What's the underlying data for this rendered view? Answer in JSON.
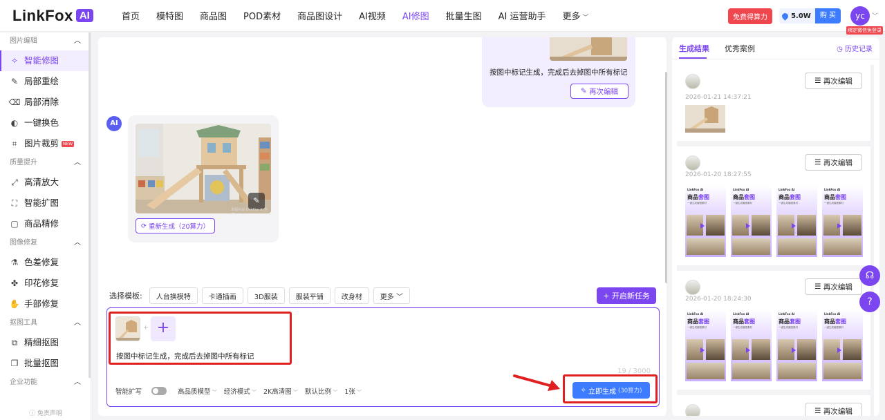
{
  "header": {
    "logo_text": "LinkFox",
    "logo_badge": "AI",
    "nav": [
      {
        "label": "首页"
      },
      {
        "label": "模特图"
      },
      {
        "label": "商品图"
      },
      {
        "label": "POD素材"
      },
      {
        "label": "商品图设计"
      },
      {
        "label": "AI视频"
      },
      {
        "label": "AI修图",
        "active": true
      },
      {
        "label": "批量生图"
      },
      {
        "label": "AI 运营助手"
      },
      {
        "label": "更多"
      }
    ],
    "free_power": "免费得算力",
    "power_value": "5.0W",
    "buy_label": "购 买",
    "avatar_initials": "yc",
    "bind_tag": "绑定微信免登录"
  },
  "sidebar": {
    "groups": [
      {
        "title": "图片编辑",
        "items": [
          {
            "label": "智能修图",
            "icon": "magic-wand-icon",
            "active": true
          },
          {
            "label": "局部重绘",
            "icon": "pencil-box-icon"
          },
          {
            "label": "局部消除",
            "icon": "eraser-icon"
          },
          {
            "label": "一键换色",
            "icon": "palette-icon"
          },
          {
            "label": "图片裁剪",
            "icon": "crop-icon",
            "badge": "NEW"
          }
        ]
      },
      {
        "title": "质量提升",
        "items": [
          {
            "label": "高清放大",
            "icon": "expand-icon"
          },
          {
            "label": "智能扩图",
            "icon": "outpaint-icon"
          },
          {
            "label": "商品精修",
            "icon": "retouch-icon"
          }
        ]
      },
      {
        "title": "图像修复",
        "items": [
          {
            "label": "色差修复",
            "icon": "color-fix-icon"
          },
          {
            "label": "印花修复",
            "icon": "pattern-icon"
          },
          {
            "label": "手部修复",
            "icon": "hand-icon"
          }
        ]
      },
      {
        "title": "抠图工具",
        "items": [
          {
            "label": "精细抠图",
            "icon": "cutout-icon"
          },
          {
            "label": "批量抠图",
            "icon": "batch-cutout-icon"
          }
        ]
      },
      {
        "title": "企业功能",
        "items": []
      }
    ],
    "disclaimer": "ⓘ 免责声明"
  },
  "chat": {
    "user_prompt": "按图中标记生成，完成后去掉图中所有标记",
    "user_edit_label": "再次编辑",
    "ai_badge": "AI",
    "watermark": "本图片由 LinkFox AI 生成",
    "regen_label": "重新生成（20算力）"
  },
  "templates": {
    "label": "选择模板:",
    "items": [
      "人台换模特",
      "卡通插画",
      "3D服装",
      "服装平铺",
      "改身材"
    ],
    "more": "更多",
    "new_task": "+ 开启新任务"
  },
  "input": {
    "prompt": "按图中标记生成，完成后去掉图中所有标记",
    "char_count": "19 / 3000",
    "smart_expand": "智能扩写",
    "options": [
      "高品质模型",
      "经济模式",
      "2K高清图",
      "默认比例",
      "1张"
    ],
    "generate_label": "立即生成",
    "generate_cost": "(30算力)"
  },
  "results": {
    "tabs": [
      "生成结果",
      "优秀案例"
    ],
    "history": "历史记录",
    "edit_label": "再次编辑",
    "cards": [
      {
        "time": "2026-01-21 14:37:21"
      },
      {
        "time": "2026-01-20 18:27:55"
      },
      {
        "time": "2026-01-20 18:24:30"
      },
      {
        "time": ""
      }
    ],
    "poster_brand": "LinkFox AI",
    "poster_title_a": "商品",
    "poster_title_b": "套图",
    "poster_sub": "一键生成套图素材"
  },
  "colors": {
    "brand": "#7b45f0",
    "primary_blue": "#3d7cff",
    "alert_red": "#e02020"
  }
}
